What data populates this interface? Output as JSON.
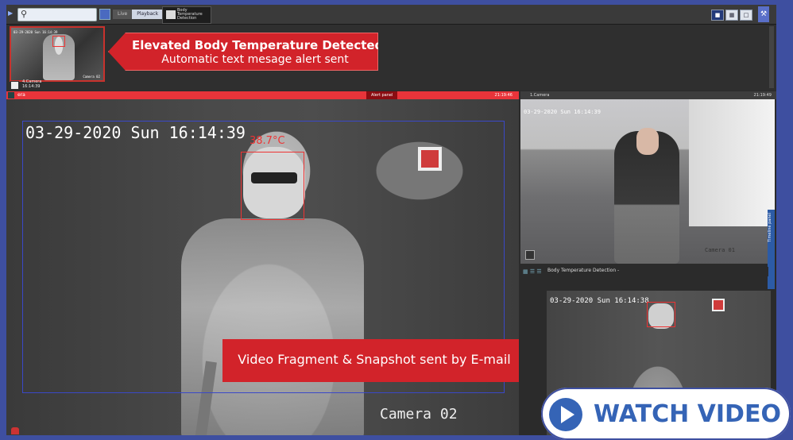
{
  "search": {
    "placeholder": ""
  },
  "toolbar": {
    "mode_live": "Live",
    "mode_playback": "Playback",
    "tab_label": "Body Temperature Detection"
  },
  "alert_strip": {
    "thumb_timestamp": "03-29-2020 Sun 16:14:39",
    "thumb_camera": "Camera 02",
    "thumb_label": "4.Camera",
    "thumb_time": "16:14:39",
    "callout_title": "Elevated Body Temperature Detected",
    "callout_sub": "Automatic text mesage alert sent"
  },
  "main_view": {
    "header_name": "era",
    "alert_panel": "Alert panel",
    "header_time": "21:19:46",
    "timestamp": "03-29-2020 Sun 16:14:39",
    "temperature": "38.7°C",
    "camera_label": "Camera 02",
    "callout": "Video Fragment & Snapshot sent by E-mail"
  },
  "side_camera": {
    "header_name": "1.Camera",
    "header_time": "21:19:49",
    "timestamp": "03-29-2020 Sun 16:14:39",
    "camera_label": "Camera 01"
  },
  "side_panel": {
    "label": "Timeline panel"
  },
  "detection": {
    "title": "Body Temperature Detection -",
    "timestamp": "03-29-2020 Sun 16:14:38"
  },
  "watch": {
    "label": "WATCH VIDEO"
  },
  "colors": {
    "alert_red": "#d2232a",
    "brand_blue": "#3564b6",
    "background": "#3e4fa0"
  }
}
